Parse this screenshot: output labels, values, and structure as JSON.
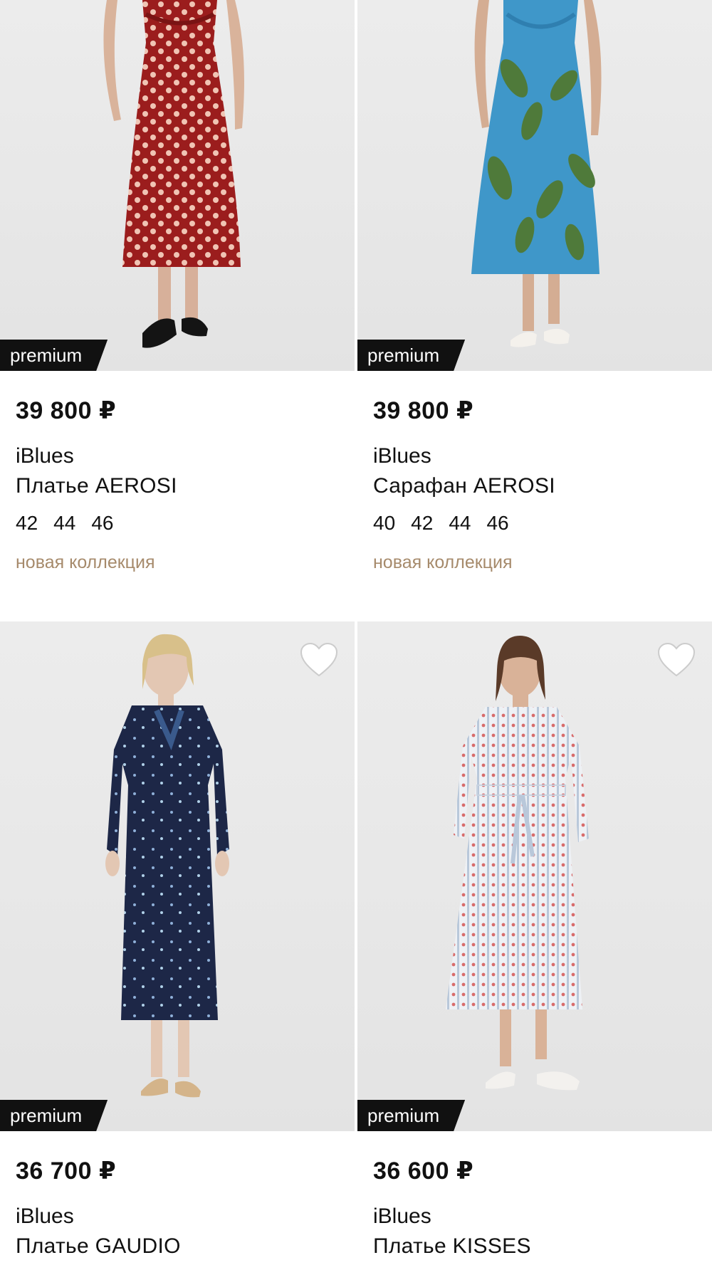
{
  "products": [
    {
      "badge": "premium",
      "price": "39 800 ₽",
      "brand": "iBlues",
      "title": "Платье AEROSI",
      "sizes": [
        "42",
        "44",
        "46"
      ],
      "tag": "новая коллекция",
      "dress_color": "#9b1d1d",
      "dot_color": "#f0c4b4"
    },
    {
      "badge": "premium",
      "price": "39 800 ₽",
      "brand": "iBlues",
      "title": "Сарафан AEROSI",
      "sizes": [
        "40",
        "42",
        "44",
        "46"
      ],
      "tag": "новая коллекция",
      "dress_color": "#3f97c9",
      "leaf_color": "#4f7a3a"
    },
    {
      "badge": "premium",
      "price": "36 700 ₽",
      "brand": "iBlues",
      "title": "Платье GAUDIO",
      "dress_color": "#1d2747",
      "icon": "heart-outline-icon"
    },
    {
      "badge": "premium",
      "price": "36 600 ₽",
      "brand": "iBlues",
      "title": "Платье KISSES",
      "dress_color": "#eef1f5",
      "stripe_color": "#b9c8da",
      "flower_color": "#d86c6c",
      "icon": "heart-outline-icon"
    }
  ],
  "colors": {
    "badge_bg": "#111111",
    "tag_text": "#a68a6b",
    "photo_bg": "#e8e8e8"
  }
}
